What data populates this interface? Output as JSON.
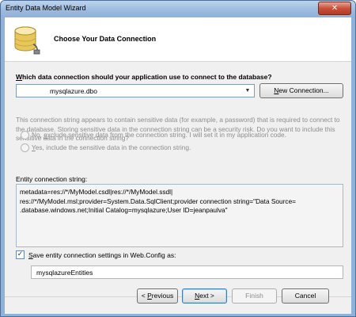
{
  "window": {
    "title": "Entity Data Model Wizard",
    "close_glyph": "✕"
  },
  "header": {
    "title": "Choose Your Data Connection",
    "icon": "database-icon"
  },
  "connection": {
    "question_prefix": "",
    "question_accel": "W",
    "question_rest": "hich data connection should your application use to connect to the database?",
    "selected": "mysqlazure.dbo",
    "new_button_accel": "N",
    "new_button_rest": "ew Connection..."
  },
  "sensitive": {
    "info": "This connection string appears to contain sensitive data (for example, a password) that is required to connect to the database. Storing sensitive data in the connection string can be a security risk. Do you want to include this sensitive data in the connection string?",
    "option_no_prefix": "No, ",
    "option_no_accel": "e",
    "option_no_rest": "xclude sensitive data from the connection string. I will set it in my application code.",
    "option_yes_accel": "Y",
    "option_yes_rest": "es, include the sensitive data in the connection string."
  },
  "connection_string": {
    "label": "Entity connection string:",
    "value": "metadata=res://*/MyModel.csdl|res://*/MyModel.ssdl|\nres://*/MyModel.msl;provider=System.Data.SqlClient;provider connection string=\"Data Source=                .database.windows.net;Initial Catalog=mysqlazure;User ID=jeanpaulva\""
  },
  "save": {
    "checked": true,
    "label_accel": "S",
    "label_rest": "ave entity connection settings in Web.Config as:",
    "entities_name": "mysqlazureEntities"
  },
  "buttons": {
    "previous_prefix": "< ",
    "previous_accel": "P",
    "previous_rest": "revious",
    "next_accel": "N",
    "next_rest": "ext >",
    "finish": "Finish",
    "cancel": "Cancel"
  },
  "colors": {
    "titlebar": "#9dbbe0",
    "close_button": "#c9503a",
    "disabled_text": "#8d8d8d",
    "dialog_background": "#f0f0f0"
  }
}
